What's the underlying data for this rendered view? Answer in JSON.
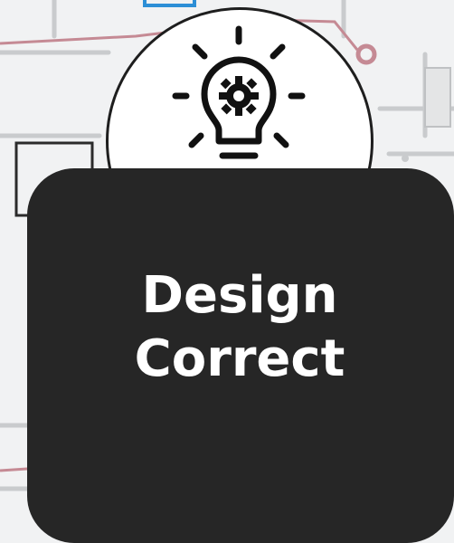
{
  "card": {
    "lines": [
      "Design",
      "Correct"
    ]
  },
  "icon": {
    "name": "lightbulb-gear-icon"
  },
  "colors": {
    "card_background": "#262626",
    "card_text": "#ffffff",
    "badge_fill": "#ffffff",
    "badge_stroke": "#1e1e1e",
    "circuit_red": "#c58a94",
    "circuit_blue": "#2d8fd6",
    "circuit_gray": "#bdbdbd"
  }
}
